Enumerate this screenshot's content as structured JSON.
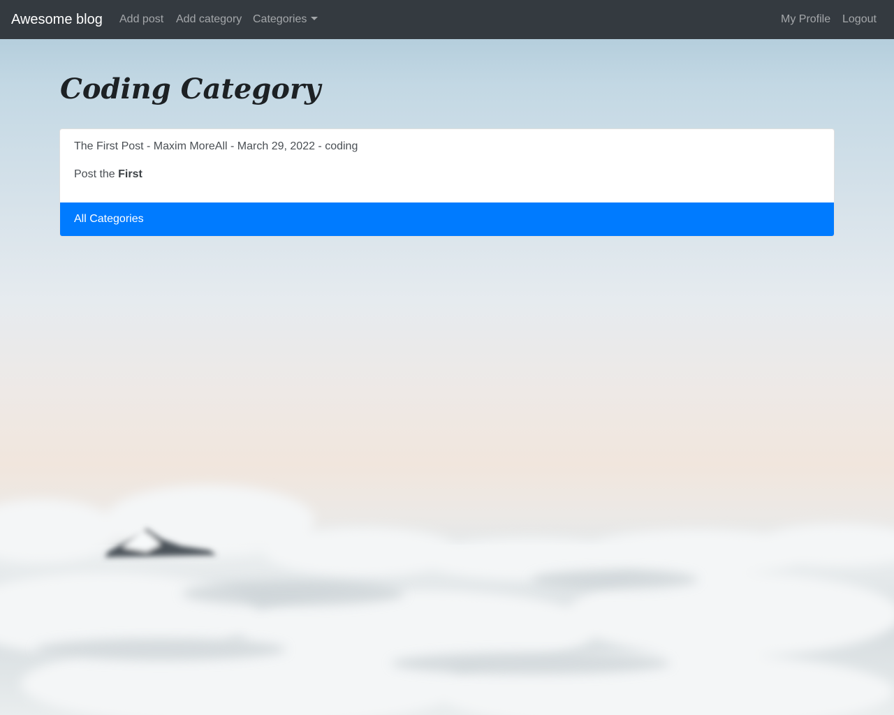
{
  "navbar": {
    "brand": "Awesome blog",
    "links": {
      "add_post": "Add post",
      "add_category": "Add category",
      "categories": "Categories",
      "my_profile": "My Profile",
      "logout": "Logout"
    }
  },
  "page": {
    "title": "Coding Category"
  },
  "posts": [
    {
      "meta": "The First Post - Maxim MoreAll - March 29, 2022 - coding",
      "body_prefix": "Post the ",
      "body_bold": "First"
    }
  ],
  "footer_button": "All Categories",
  "colors": {
    "navbar_bg": "#343a40",
    "primary": "#007bff"
  },
  "icons": {
    "dropdown": "caret-down-icon",
    "background": "mountain-above-clouds"
  }
}
